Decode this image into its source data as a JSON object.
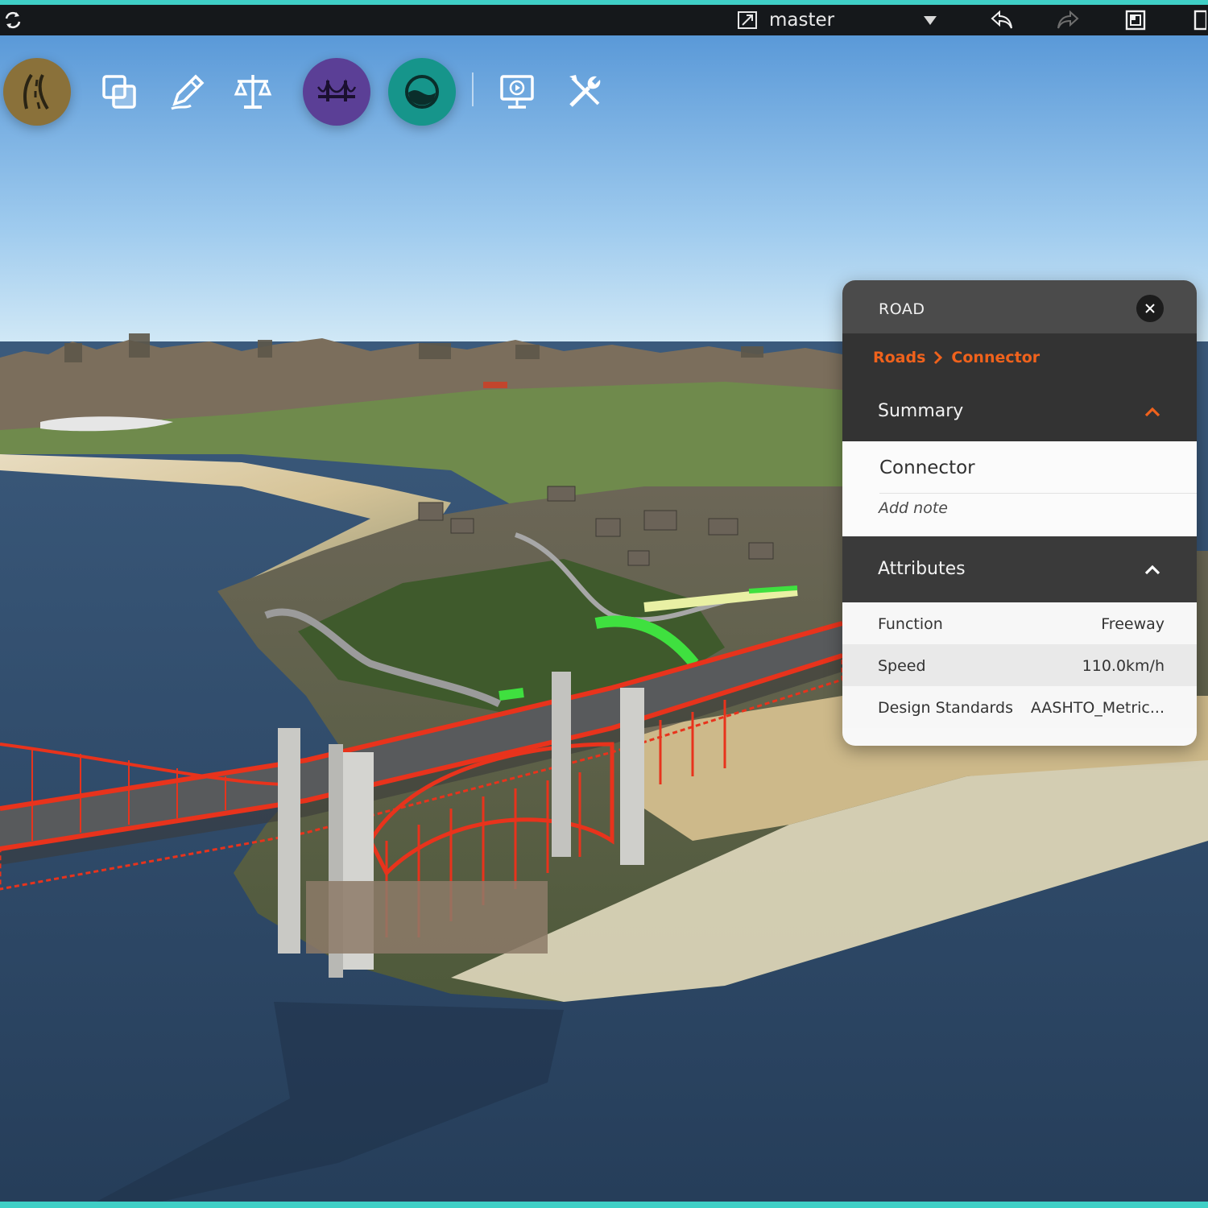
{
  "topbar": {
    "branch": "master",
    "icons": [
      "sync-icon",
      "branch-icon",
      "dropdown-icon",
      "undo-icon",
      "redo-icon",
      "window-icon",
      "panel-icon"
    ]
  },
  "toolbar": {
    "tools": [
      {
        "name": "roads",
        "icon": "road-icon",
        "color": "#8a713a"
      },
      {
        "name": "copy",
        "icon": "copy-icon"
      },
      {
        "name": "sketch",
        "icon": "pencil-icon"
      },
      {
        "name": "analysis",
        "icon": "balance-icon"
      },
      {
        "name": "bridges",
        "icon": "bridge-icon",
        "color": "#5b3f96"
      },
      {
        "name": "water",
        "icon": "water-icon",
        "color": "#16958b"
      },
      {
        "name": "present",
        "icon": "presentation-icon"
      },
      {
        "name": "settings",
        "icon": "tools-icon"
      }
    ]
  },
  "panel": {
    "title": "ROAD",
    "breadcrumb": {
      "parent": "Roads",
      "current": "Connector",
      "color": "#f0621c"
    },
    "summary": {
      "label": "Summary",
      "name": "Connector",
      "note_placeholder": "Add note"
    },
    "attributes": {
      "label": "Attributes",
      "rows": [
        {
          "key": "Function",
          "value": "Freeway"
        },
        {
          "key": "Speed",
          "value": "110.0km/h"
        },
        {
          "key": "Design Standards",
          "value": "AASHTO_Metric..."
        }
      ]
    }
  },
  "colors": {
    "accent": "#f0621c",
    "frame": "#3fcfc6",
    "bridge": "#e8331c"
  }
}
